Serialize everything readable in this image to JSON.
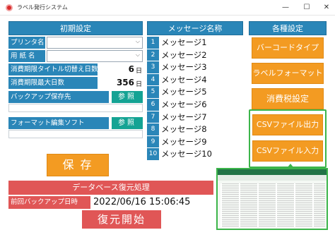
{
  "window": {
    "title": "ラベル発行システム",
    "minimize_glyph": "—",
    "maximize_glyph": "☐",
    "close_glyph": "✕"
  },
  "initial_settings": {
    "header": "初期設定",
    "printer_label": "プリンタ名",
    "paper_label": "用 紙 名",
    "expiry_switch_label": "消費期限タイトル切替え日数",
    "expiry_switch_value": "6",
    "expiry_switch_unit": "日",
    "expiry_max_label": "消費期限最大日数",
    "expiry_max_value": "356",
    "expiry_max_unit": "日",
    "backup_label": "バックアップ保存先",
    "backup_button": "参照",
    "format_label": "フォーマット編集ソフト",
    "format_button": "参照",
    "save_button": "保 存"
  },
  "messages": {
    "header": "メッセージ名称",
    "items": [
      {
        "num": "1",
        "text": "メッセージ1"
      },
      {
        "num": "2",
        "text": "メッセージ2"
      },
      {
        "num": "3",
        "text": "メッセージ3"
      },
      {
        "num": "4",
        "text": "メッセージ4"
      },
      {
        "num": "5",
        "text": "メッセージ5"
      },
      {
        "num": "6",
        "text": "メッセージ6"
      },
      {
        "num": "7",
        "text": "メッセージ7"
      },
      {
        "num": "8",
        "text": "メッセージ8"
      },
      {
        "num": "9",
        "text": "メッセージ9"
      },
      {
        "num": "10",
        "text": "メッセージ10"
      }
    ]
  },
  "various_settings": {
    "header": "各種設定",
    "barcode_type": "バーコードタイプ",
    "label_format": "ラベルフォーマット",
    "consumption_tax": "消費税設定",
    "csv_output": "CSVファイル出力",
    "csv_input": "CSVファイル入力"
  },
  "restore": {
    "header": "データベース復元処理",
    "last_backup_label": "前回バックアップ日時",
    "last_backup_value": "2022/06/16 15:06:45",
    "start_button": "復元開始"
  },
  "colors": {
    "blue": "#2a86b8",
    "orange": "#f39b22",
    "green_button": "#14a394",
    "red": "#e05656",
    "highlight": "#3cb54a"
  }
}
